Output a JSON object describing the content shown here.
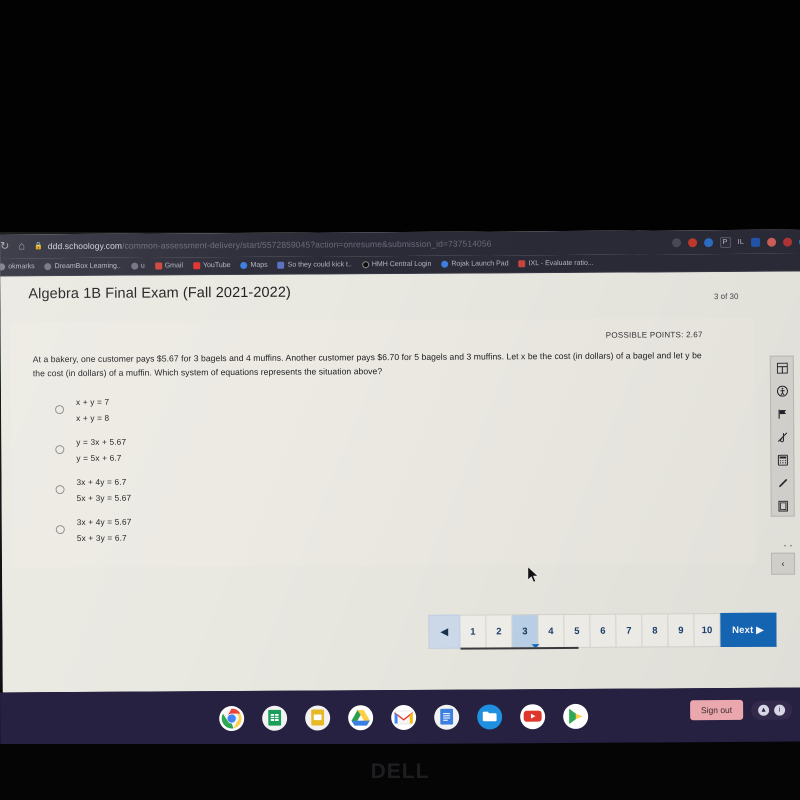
{
  "browser": {
    "reload_icon": "reload-icon",
    "home_icon": "home-icon",
    "lock_icon": "lock-icon",
    "url_host": "ddd.schoology.com",
    "url_path": "/common-assessment-delivery/start/5572859045?action=onresume&submission_id=737514056",
    "extensions": [
      {
        "name": "extension-icon-1",
        "label": "",
        "color": "#4a4a58"
      },
      {
        "name": "extension-icon-2",
        "label": "",
        "color": "#c0392b"
      },
      {
        "name": "extension-icon-3",
        "label": "",
        "color": "#2b6fc4"
      },
      {
        "name": "extension-icon-4",
        "label": "P",
        "color": "#2f2f3c"
      },
      {
        "name": "extension-icon-5",
        "label": "IL",
        "color": "#2b2b38"
      },
      {
        "name": "extension-icon-6",
        "label": "",
        "color": "#2255aa"
      },
      {
        "name": "extension-icon-7",
        "label": "",
        "color": "#d0605a"
      },
      {
        "name": "extension-icon-8",
        "label": "",
        "color": "#b03535"
      },
      {
        "name": "profile-avatar",
        "label": "",
        "color": "#2f7fd0"
      }
    ],
    "bookmarks": [
      {
        "label": "okmarks",
        "color": "#7a7b88"
      },
      {
        "label": "DreamBox Learning..",
        "color": "#6e7080"
      },
      {
        "label": "u",
        "color": "#6e7080"
      },
      {
        "label": "Gmail",
        "color": "#d04437"
      },
      {
        "label": "YouTube",
        "color": "#e02f2f"
      },
      {
        "label": "Maps",
        "color": "#3b7de0"
      },
      {
        "label": "So they could kick t..",
        "color": "#5a6fc0"
      },
      {
        "label": "HMH Central Login",
        "color": "#0f0f12"
      },
      {
        "label": "Rojak Launch Pad",
        "color": "#3f7fe0"
      },
      {
        "label": "IXL - Evaluate ratio...",
        "color": "#c9453c"
      }
    ],
    "overflow_label": "»"
  },
  "exam": {
    "title": "Algebra 1B Final Exam (Fall 2021-2022)",
    "counter": "3 of 30",
    "possible_points": "POSSIBLE POINTS: 2.67",
    "question": "At a bakery, one customer pays $5.67 for 3 bagels and 4 muffins. Another customer pays $6.70 for 5 bagels and 3 muffins. Let x be the cost (in dollars) of a bagel and let y be the cost (in dollars) of a muffin. Which system of equations represents the situation above?",
    "choices": [
      {
        "line1": "x + y = 7",
        "line2": "x + y = 8",
        "selected": false
      },
      {
        "line1": "y = 3x + 5.67",
        "line2": "y = 5x + 6.7",
        "selected": false
      },
      {
        "line1": "3x + 4y = 6.7",
        "line2": "5x + 3y = 5.67",
        "selected": false
      },
      {
        "line1": "3x + 4y = 5.67",
        "line2": "5x + 3y = 6.7",
        "selected": false
      }
    ]
  },
  "tools": [
    {
      "name": "calculator-tool-icon",
      "glyph": "⌸"
    },
    {
      "name": "accessibility-tool-icon",
      "glyph": "Ⓕ"
    },
    {
      "name": "flag-question-icon",
      "glyph": "⚑"
    },
    {
      "name": "mute-audio-icon",
      "glyph": "♪"
    },
    {
      "name": "calculator-icon",
      "glyph": "☰"
    },
    {
      "name": "line-reader-icon",
      "glyph": "╱"
    },
    {
      "name": "notepad-icon",
      "glyph": "▤"
    }
  ],
  "rail": {
    "dots": "• •",
    "collapse_glyph": "‹"
  },
  "pagination": {
    "prev_glyph": "◀",
    "pages": [
      "1",
      "2",
      "3",
      "4",
      "5",
      "6",
      "7",
      "8",
      "9",
      "10"
    ],
    "active_page": "3",
    "next_label": "Next ▶",
    "accent_color": "#1668b8"
  },
  "shelf": {
    "apps": [
      {
        "name": "chrome-app-icon",
        "label": "",
        "color": "#ffffff"
      },
      {
        "name": "sheets-app-icon",
        "label": "",
        "color": "#ffffff"
      },
      {
        "name": "slides-app-icon",
        "label": "",
        "color": "#ffffff"
      },
      {
        "name": "drive-app-icon",
        "label": "",
        "color": "#ffffff"
      },
      {
        "name": "gmail-app-icon",
        "label": "",
        "color": "#ffffff"
      },
      {
        "name": "docs-app-icon",
        "label": "",
        "color": "#ffffff"
      },
      {
        "name": "files-app-icon",
        "label": "",
        "color": "#1f8fe0"
      },
      {
        "name": "youtube-app-icon",
        "label": "",
        "color": "#ffffff"
      },
      {
        "name": "play-store-app-icon",
        "label": "",
        "color": "#ffffff"
      }
    ],
    "sign_out_label": "Sign out",
    "tray_icon_1": "▲",
    "tray_icon_2": "i"
  },
  "device": {
    "brand": "DELL"
  }
}
